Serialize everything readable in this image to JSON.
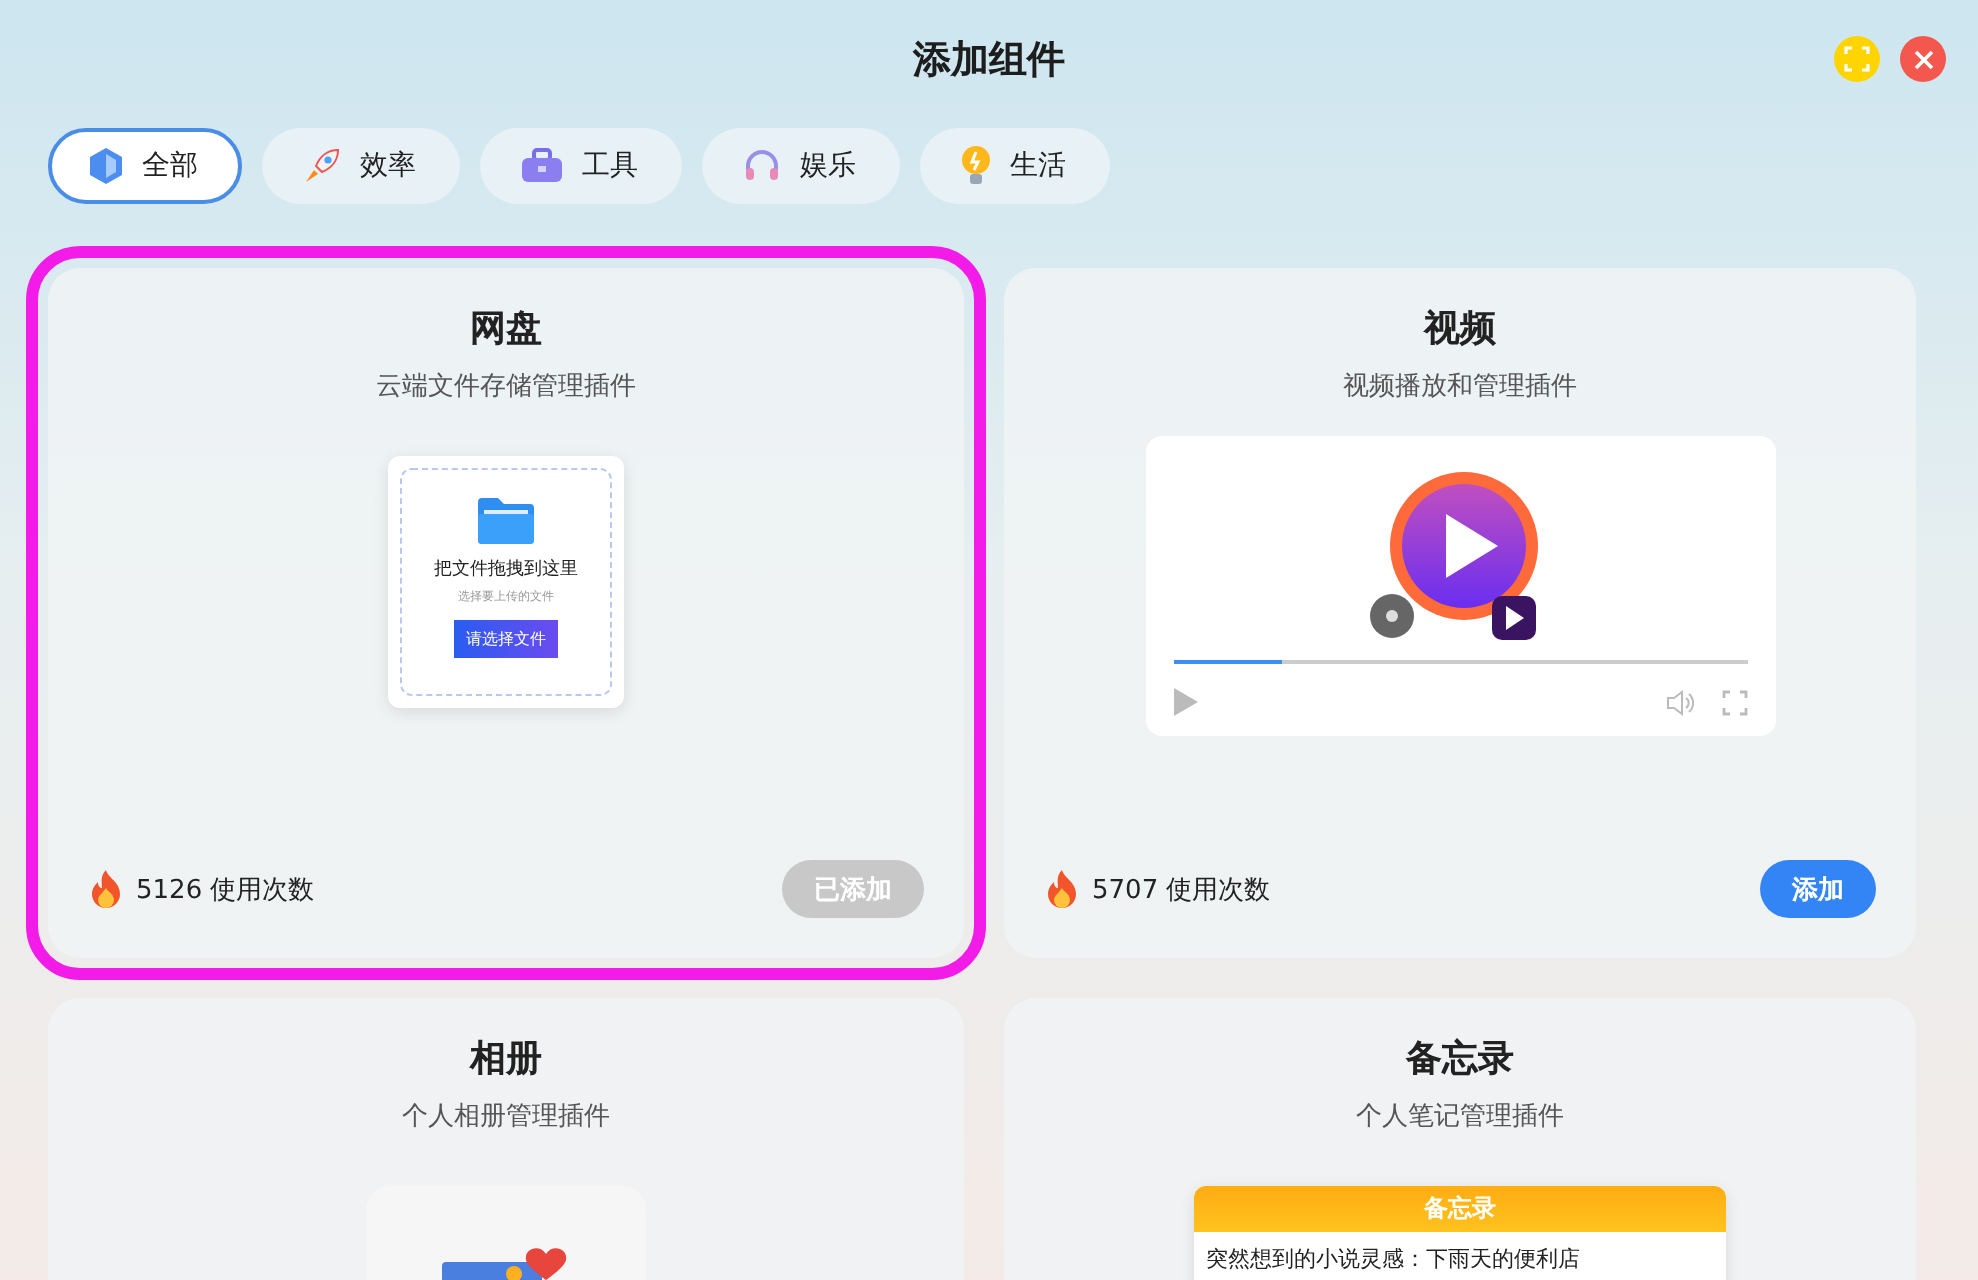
{
  "window": {
    "title": "添加组件"
  },
  "tabs": [
    {
      "label": "全部",
      "selected": true
    },
    {
      "label": "效率",
      "selected": false
    },
    {
      "label": "工具",
      "selected": false
    },
    {
      "label": "娱乐",
      "selected": false
    },
    {
      "label": "生活",
      "selected": false
    }
  ],
  "cards": [
    {
      "kind": "upload",
      "title": "网盘",
      "subtitle": "云端文件存储管理插件",
      "selected": true,
      "preview": {
        "heading": "把文件拖拽到这里",
        "hint": "选择要上传的文件",
        "button": "请选择文件"
      },
      "usage": "5126 使用次数",
      "button": {
        "label": "已添加",
        "added": true
      }
    },
    {
      "kind": "video",
      "title": "视频",
      "subtitle": "视频播放和管理插件",
      "selected": false,
      "preview": {
        "level": 0.19
      },
      "usage": "5707 使用次数",
      "button": {
        "label": "添加",
        "added": false
      }
    },
    {
      "kind": "album",
      "title": "相册",
      "subtitle": "个人相册管理插件",
      "selected": false
    },
    {
      "kind": "memo",
      "title": "备忘录",
      "subtitle": "个人笔记管理插件",
      "selected": false,
      "preview": {
        "heading": "备忘录",
        "note": "突然想到的小说灵感：下雨天的便利店"
      }
    }
  ]
}
